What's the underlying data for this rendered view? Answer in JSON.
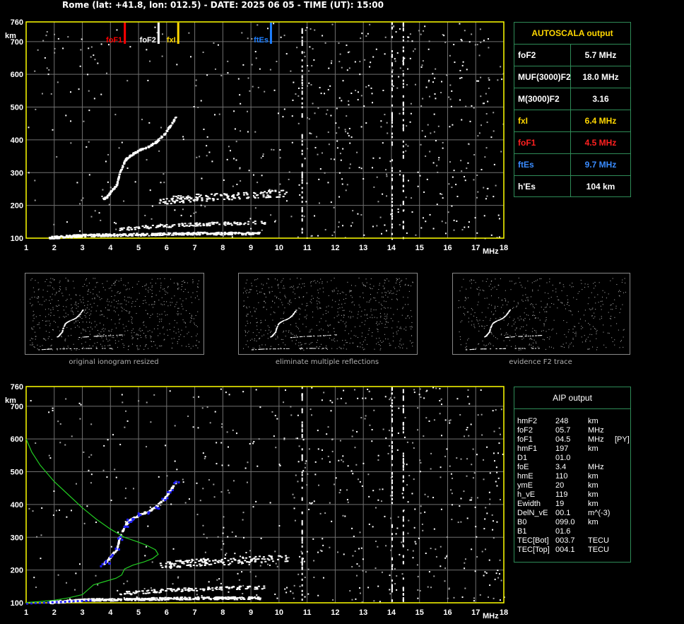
{
  "header": "Rome (lat: +41.8, lon: 012.5) - DATE: 2025 06 05 - TIME (UT): 15:00",
  "colors": {
    "axis": "#ffff00",
    "grid": "#707070",
    "trace": "#ffffff",
    "foF1": "#ff0000",
    "foF2": "#ffffff",
    "fxI": "#ffd700",
    "ftEs": "#1e7fff",
    "profile": "#22cc22",
    "dots": "#2020ff",
    "border": "#2e8b57"
  },
  "chart_data": [
    {
      "type": "scatter",
      "id": "main-ionogram",
      "xlabel": "MHz",
      "ylabel": "km",
      "xlim": [
        1,
        18
      ],
      "ylim": [
        100,
        760
      ],
      "x_ticks": [
        "1",
        "2",
        "3",
        "4",
        "5",
        "6",
        "7",
        "8",
        "9",
        "10",
        "11",
        "12",
        "13",
        "14",
        "15",
        "16",
        "17",
        "18"
      ],
      "y_ticks": [
        "100",
        "200",
        "300",
        "400",
        "500",
        "600",
        "700",
        "760"
      ],
      "markers": [
        {
          "name": "foF1",
          "freq": 4.5
        },
        {
          "name": "foF2",
          "freq": 5.7
        },
        {
          "name": "fxI",
          "freq": 6.4
        },
        {
          "name": "ftEs",
          "freq": 9.7
        }
      ],
      "trace_F": [
        [
          3.7,
          220
        ],
        [
          3.85,
          228
        ],
        [
          4.0,
          245
        ],
        [
          4.2,
          265
        ],
        [
          4.3,
          300
        ],
        [
          4.5,
          340
        ],
        [
          4.65,
          352
        ],
        [
          4.8,
          360
        ],
        [
          5.0,
          370
        ],
        [
          5.3,
          380
        ],
        [
          5.6,
          395
        ],
        [
          5.9,
          420
        ],
        [
          6.1,
          445
        ],
        [
          6.3,
          470
        ]
      ],
      "trace_Es": [
        [
          1.8,
          103
        ],
        [
          3,
          110
        ],
        [
          5,
          113
        ],
        [
          7,
          116
        ],
        [
          9.3,
          116
        ]
      ],
      "trace_F2_2hop": [
        [
          5.7,
          215
        ],
        [
          7,
          225
        ],
        [
          8.5,
          230
        ],
        [
          10.3,
          240
        ]
      ],
      "trace_E_2hop": [
        [
          4.3,
          130
        ],
        [
          6,
          140
        ],
        [
          7.5,
          145
        ],
        [
          9.5,
          150
        ]
      ]
    },
    {
      "type": "scatter",
      "id": "aip-ionogram",
      "xlabel": "MHz",
      "ylabel": "km",
      "xlim": [
        1,
        18
      ],
      "ylim": [
        100,
        760
      ],
      "x_ticks": [
        "1",
        "2",
        "3",
        "4",
        "5",
        "6",
        "7",
        "8",
        "9",
        "10",
        "11",
        "12",
        "13",
        "14",
        "15",
        "16",
        "17",
        "18"
      ],
      "y_ticks": [
        "100",
        "200",
        "300",
        "400",
        "500",
        "600",
        "700",
        "760"
      ],
      "profile": [
        [
          1.0,
          600
        ],
        [
          1.2,
          560
        ],
        [
          1.5,
          520
        ],
        [
          2.0,
          470
        ],
        [
          2.5,
          430
        ],
        [
          3.0,
          390
        ],
        [
          3.5,
          355
        ],
        [
          4.0,
          325
        ],
        [
          4.5,
          300
        ],
        [
          5.0,
          285
        ],
        [
          5.3,
          275
        ],
        [
          5.6,
          262
        ],
        [
          5.7,
          248
        ],
        [
          5.5,
          235
        ],
        [
          5.2,
          225
        ],
        [
          4.8,
          215
        ],
        [
          4.5,
          203
        ],
        [
          4.4,
          185
        ],
        [
          4.2,
          175
        ],
        [
          3.8,
          165
        ],
        [
          3.4,
          155
        ],
        [
          3.2,
          140
        ],
        [
          3.0,
          125
        ],
        [
          2.5,
          115
        ],
        [
          2.0,
          108
        ],
        [
          1.5,
          104
        ],
        [
          1.0,
          101
        ]
      ]
    }
  ],
  "autoscala": {
    "title": "AUTOSCALA output",
    "rows": [
      {
        "key": "foF2",
        "value": "5.7 MHz",
        "color": "#ffffff"
      },
      {
        "key": "MUF(3000)F2",
        "value": "18.0 MHz",
        "color": "#ffffff"
      },
      {
        "key": "M(3000)F2",
        "value": "3.16",
        "color": "#ffffff"
      },
      {
        "key": "fxI",
        "value": "6.4 MHz",
        "color": "#ffd700"
      },
      {
        "key": "foF1",
        "value": "4.5 MHz",
        "color": "#ff2020"
      },
      {
        "key": "ftEs",
        "value": "9.7 MHz",
        "color": "#3a8cff"
      },
      {
        "key": "h'Es",
        "value": "104    km",
        "color": "#ffffff"
      }
    ]
  },
  "thumbnails": [
    {
      "caption": "original ionogram resized"
    },
    {
      "caption": "eliminate multiple reflections"
    },
    {
      "caption": "evidence F2 trace"
    }
  ],
  "aip": {
    "title": "AIP output",
    "rows": [
      {
        "name": "hmF2",
        "val": "248",
        "unit": "km",
        "extra": ""
      },
      {
        "name": "foF2",
        "val": "05.7",
        "unit": "MHz",
        "extra": ""
      },
      {
        "name": "foF1",
        "val": "04.5",
        "unit": "MHz",
        "extra": "[PY]"
      },
      {
        "name": "hmF1",
        "val": "197",
        "unit": "km",
        "extra": ""
      },
      {
        "name": "D1",
        "val": "01.0",
        "unit": "",
        "extra": ""
      },
      {
        "name": "foE",
        "val": "3.4",
        "unit": "MHz",
        "extra": ""
      },
      {
        "name": "hmE",
        "val": "110",
        "unit": "km",
        "extra": ""
      },
      {
        "name": "ymE",
        "val": "20",
        "unit": "km",
        "extra": ""
      },
      {
        "name": "h_vE",
        "val": "119",
        "unit": "km",
        "extra": ""
      },
      {
        "name": "Ewidth",
        "val": "19",
        "unit": "km",
        "extra": ""
      },
      {
        "name": "DelN_vE",
        "val": "00.1",
        "unit": "m^(-3)",
        "extra": ""
      },
      {
        "name": "B0",
        "val": "099.0",
        "unit": "km",
        "extra": ""
      },
      {
        "name": "B1",
        "val": "01.6",
        "unit": "",
        "extra": ""
      },
      {
        "name": "TEC[Bot]",
        "val": "003.7",
        "unit": "TECU",
        "extra": ""
      },
      {
        "name": "TEC[Top]",
        "val": "004.1",
        "unit": "TECU",
        "extra": ""
      }
    ]
  }
}
